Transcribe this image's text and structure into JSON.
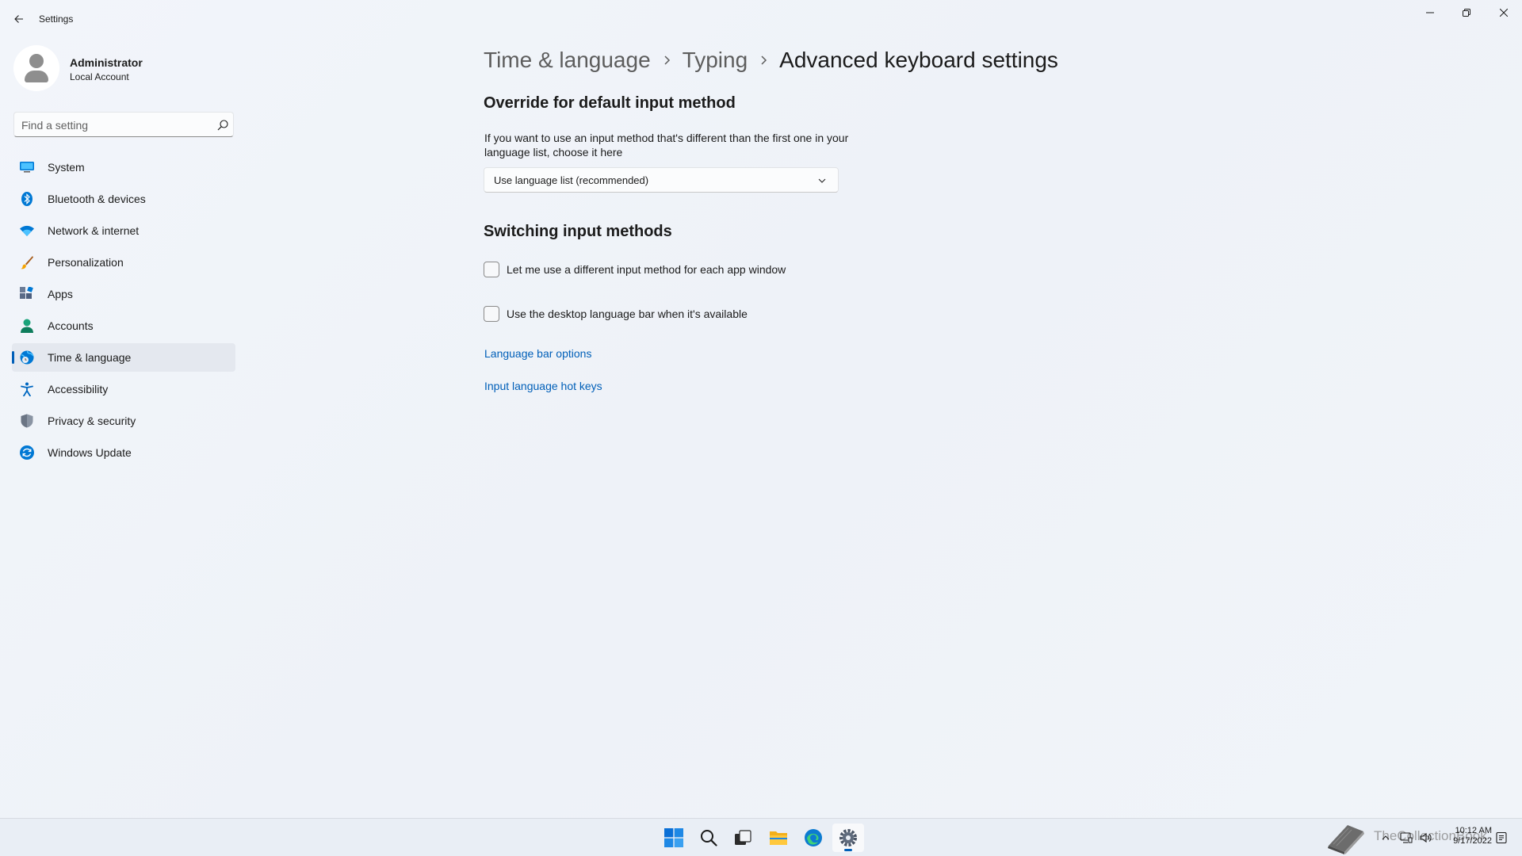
{
  "window": {
    "title": "Settings",
    "controls": {
      "minimize_icon": "minimize-icon",
      "maximize_icon": "restore-icon",
      "close_icon": "close-icon"
    }
  },
  "profile": {
    "name": "Administrator",
    "account_type": "Local Account"
  },
  "search": {
    "placeholder": "Find a setting",
    "value": ""
  },
  "sidebar": {
    "items": [
      {
        "label": "System",
        "icon": "system-icon",
        "active": false
      },
      {
        "label": "Bluetooth & devices",
        "icon": "bluetooth-icon",
        "active": false
      },
      {
        "label": "Network & internet",
        "icon": "wifi-icon",
        "active": false
      },
      {
        "label": "Personalization",
        "icon": "brush-icon",
        "active": false
      },
      {
        "label": "Apps",
        "icon": "apps-icon",
        "active": false
      },
      {
        "label": "Accounts",
        "icon": "accounts-icon",
        "active": false
      },
      {
        "label": "Time & language",
        "icon": "globe-clock-icon",
        "active": true
      },
      {
        "label": "Accessibility",
        "icon": "accessibility-icon",
        "active": false
      },
      {
        "label": "Privacy & security",
        "icon": "shield-icon",
        "active": false
      },
      {
        "label": "Windows Update",
        "icon": "update-icon",
        "active": false
      }
    ]
  },
  "breadcrumb": [
    "Time & language",
    "Typing",
    "Advanced keyboard settings"
  ],
  "sections": {
    "override": {
      "heading": "Override for default input method",
      "description": "If you want to use an input method that's different than the first one in your language list, choose it here",
      "dropdown_value": "Use language list (recommended)"
    },
    "switching": {
      "heading": "Switching input methods",
      "checkbox_per_app": {
        "label": "Let me use a different input method for each app window",
        "checked": false
      },
      "checkbox_language_bar": {
        "label": "Use the desktop language bar when it's available",
        "checked": false
      }
    },
    "links": {
      "language_bar_options": "Language bar options",
      "input_language_hot_keys": "Input language hot keys"
    }
  },
  "taskbar": {
    "apps": [
      "start-icon",
      "search-icon",
      "task-view-icon",
      "file-explorer-icon",
      "edge-icon",
      "settings-icon"
    ],
    "active_app": "settings-icon",
    "watermark": "TheCollectionBook",
    "time": "10:12 AM",
    "date": "9/17/2022"
  },
  "colors": {
    "accent": "#005fb8",
    "background": "#eef2f8",
    "active_nav": "#e4e8ef"
  }
}
